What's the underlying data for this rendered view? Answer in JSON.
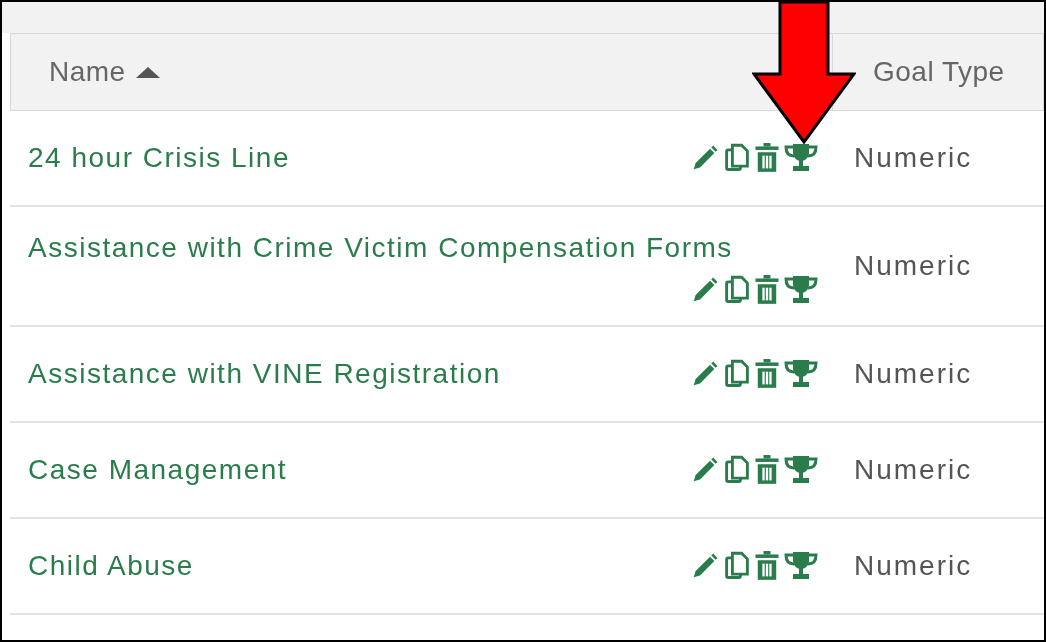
{
  "table": {
    "columns": [
      {
        "label": "Name",
        "sorted_ascending": true
      },
      {
        "label": "Goal Type",
        "sorted_ascending": false
      }
    ],
    "rows": [
      {
        "name": "24 hour Crisis Line",
        "goal_type": "Numeric"
      },
      {
        "name": "Assistance with Crime Victim Compensation Forms",
        "goal_type": "Numeric"
      },
      {
        "name": "Assistance with VINE Registration",
        "goal_type": "Numeric"
      },
      {
        "name": "Case Management",
        "goal_type": "Numeric"
      },
      {
        "name": "Child Abuse",
        "goal_type": "Numeric"
      }
    ]
  }
}
